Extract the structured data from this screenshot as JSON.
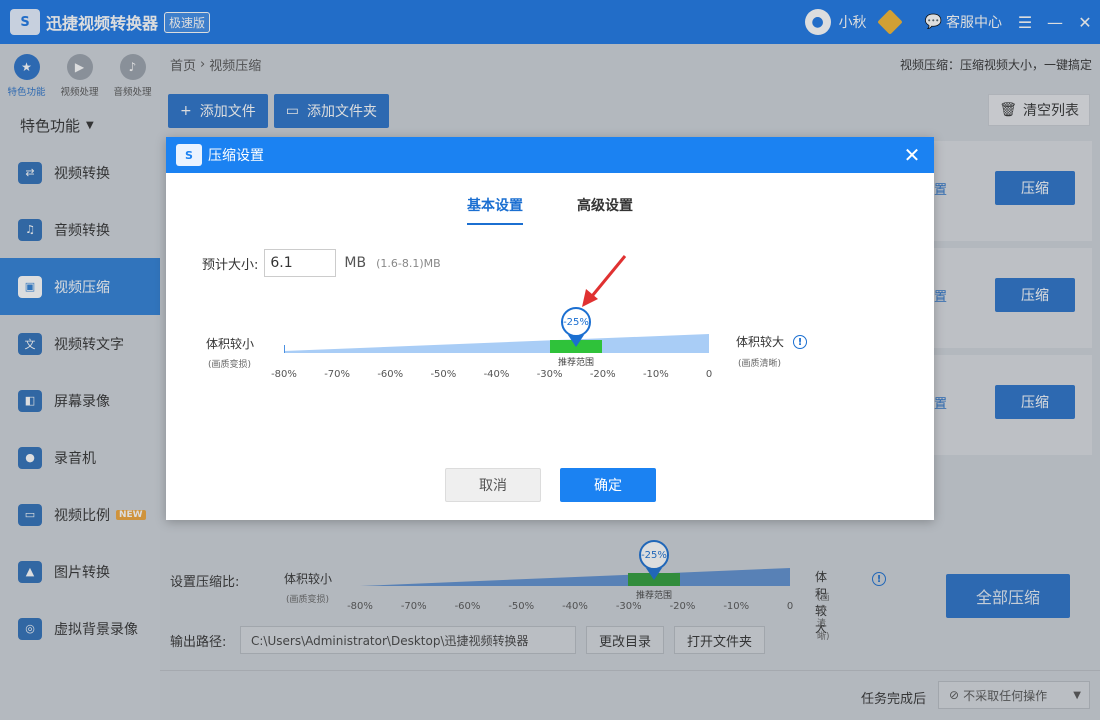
{
  "app": {
    "logo_text": "S",
    "title": "迅捷视频转换器",
    "edition": "极速版",
    "username": "小秋",
    "service_label": "客服中心",
    "menu_icon": "☰",
    "min_icon": "—",
    "close_icon": "✕"
  },
  "sidebar": {
    "top_tabs": [
      {
        "label": "特色功能",
        "icon": "★"
      },
      {
        "label": "视频处理",
        "icon": "▶"
      },
      {
        "label": "音频处理",
        "icon": "♪"
      }
    ],
    "section_title": "特色功能",
    "items": [
      {
        "label": "视频转换",
        "icon": "⇄"
      },
      {
        "label": "音频转换",
        "icon": "♫"
      },
      {
        "label": "视频压缩",
        "icon": "▣"
      },
      {
        "label": "视频转文字",
        "icon": "文"
      },
      {
        "label": "屏幕录像",
        "icon": "◧"
      },
      {
        "label": "录音机",
        "icon": "●"
      },
      {
        "label": "视频比例",
        "icon": "▭",
        "badge": "NEW"
      },
      {
        "label": "图片转换",
        "icon": "▲"
      },
      {
        "label": "虚拟背景录像",
        "icon": "◎"
      }
    ]
  },
  "main": {
    "breadcrumb_home": "首页",
    "breadcrumb_sep": "›",
    "breadcrumb_current": "视频压缩",
    "hint": "视频压缩：压缩视频大小，一键搞定",
    "add_file": "添加文件",
    "add_folder": "添加文件夹",
    "clear_list": "清空列表",
    "row_link": "置",
    "row_compress": "压缩",
    "ratio_label": "设置压缩比:",
    "output_label": "输出路径:",
    "output_path": "C:\\Users\\Administrator\\Desktop\\迅捷视频转换器",
    "change_dir": "更改目录",
    "open_folder": "打开文件夹",
    "compress_all": "全部压缩",
    "task_label": "任务完成后",
    "task_option": "不采取任何操作"
  },
  "slider": {
    "left_label": "体积较小",
    "left_sub": "(画质变损)",
    "right_label": "体积较大",
    "right_sub": "(画质清晰)",
    "ticks": [
      "-80%",
      "-70%",
      "-60%",
      "-50%",
      "-40%",
      "-30%",
      "-20%",
      "-10%",
      "0"
    ],
    "recommend_label": "推荐范围",
    "pin_value": "-25%",
    "info_icon": "!"
  },
  "dialog": {
    "logo_text": "S",
    "title": "压缩设置",
    "tab_basic": "基本设置",
    "tab_advanced": "高级设置",
    "size_label": "预计大小:",
    "size_value": "6.1",
    "size_unit": "MB",
    "size_range": "(1.6-8.1)MB",
    "cancel": "取消",
    "ok": "确定"
  },
  "colors": {
    "accent": "#1b82f2",
    "recommend": "#2fc23a"
  }
}
